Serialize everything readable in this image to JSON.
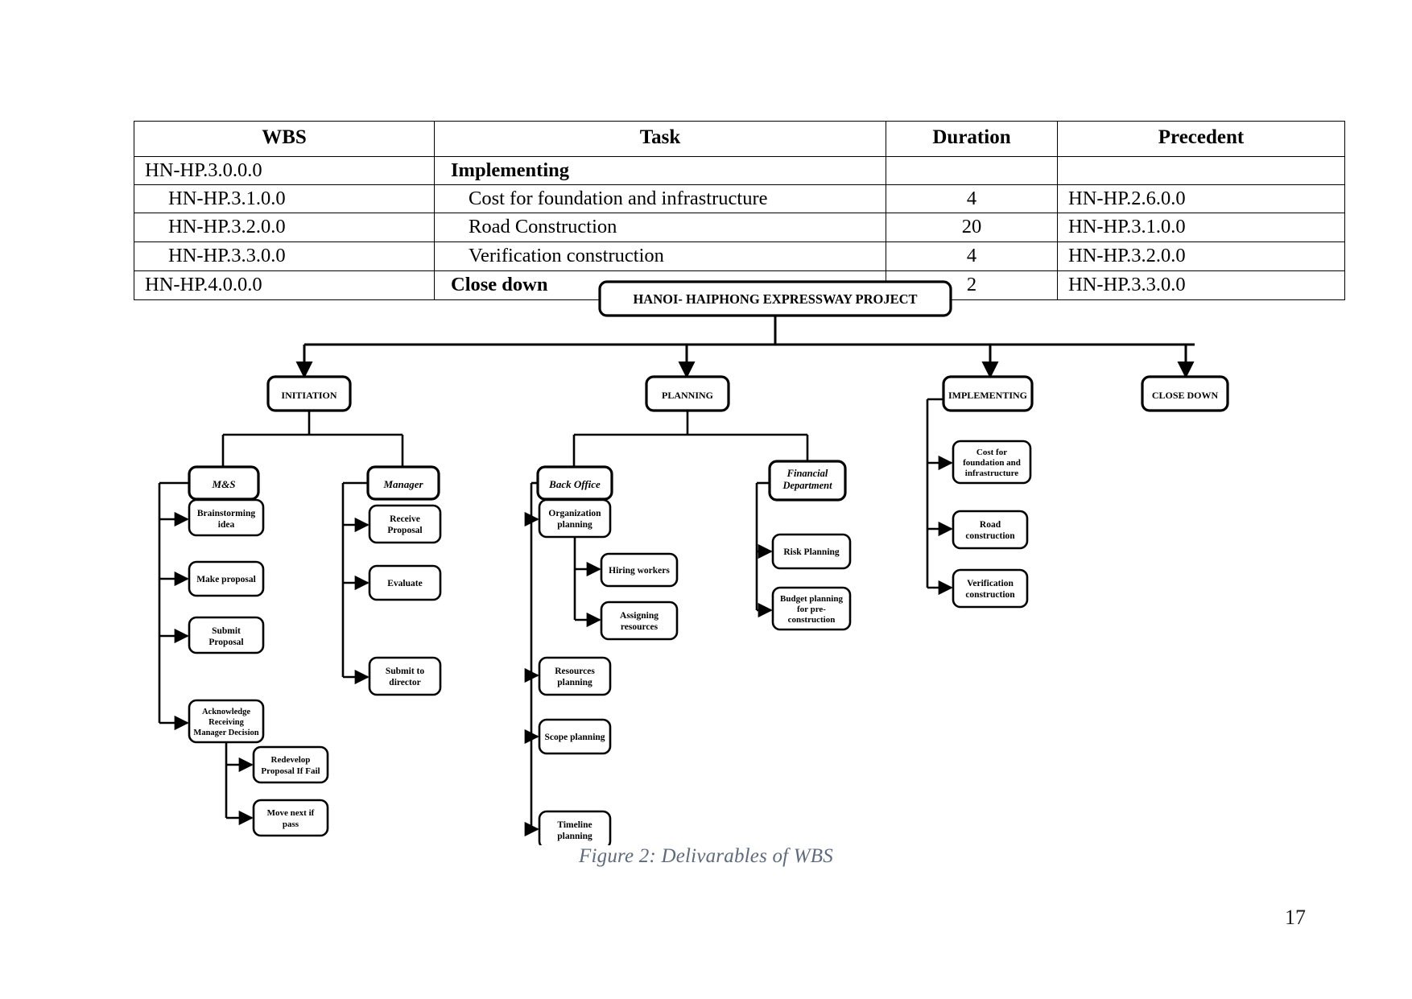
{
  "table": {
    "headers": [
      "WBS",
      "Task",
      "Duration",
      "Precedent"
    ],
    "rows": [
      {
        "wbs": "HN-HP.3.0.0.0",
        "task": "Implementing",
        "duration": "",
        "precedent": "",
        "wbs_indent": false,
        "task_bold": true,
        "task_indent": false
      },
      {
        "wbs": "HN-HP.3.1.0.0",
        "task": "Cost for foundation and infrastructure",
        "duration": "4",
        "precedent": "HN-HP.2.6.0.0",
        "wbs_indent": true,
        "task_bold": false,
        "task_indent": true
      },
      {
        "wbs": "HN-HP.3.2.0.0",
        "task": "Road Construction",
        "duration": "20",
        "precedent": "HN-HP.3.1.0.0",
        "wbs_indent": true,
        "task_bold": false,
        "task_indent": true
      },
      {
        "wbs": "HN-HP.3.3.0.0",
        "task": "Verification construction",
        "duration": "4",
        "precedent": "HN-HP.3.2.0.0",
        "wbs_indent": true,
        "task_bold": false,
        "task_indent": true
      },
      {
        "wbs": "HN-HP.4.0.0.0",
        "task": "Close down",
        "duration": "2",
        "precedent": "HN-HP.3.3.0.0",
        "wbs_indent": false,
        "task_bold": true,
        "task_indent": false
      }
    ]
  },
  "diagram": {
    "root": "HANOI- HAIPHONG EXPRESSWAY PROJECT",
    "phases": [
      "INITIATION",
      "PLANNING",
      "IMPLEMENTING",
      "CLOSE DOWN"
    ],
    "initiation": {
      "ms": "M&S",
      "ms_children": [
        "Brainstorming idea",
        "Make proposal",
        "Submit Proposal",
        "Acknowledge Receiving Manager Decision"
      ],
      "ack_children": [
        "Redevelop Proposal If Fail",
        "Move next if pass"
      ],
      "manager": "Manager",
      "manager_children": [
        "Receive Proposal",
        "Evaluate",
        "Submit to director"
      ]
    },
    "planning": {
      "back_office": "Back Office",
      "back_office_children": [
        "Organization planning",
        "Resources planning",
        "Scope planning",
        "Timeline planning"
      ],
      "organization_children": [
        "Hiring workers",
        "Assigning resources"
      ],
      "financial": "Financial Department",
      "financial_children": [
        "Risk Planning",
        "Budget planning for pre-construction"
      ]
    },
    "implementing_children": [
      "Cost for foundation and infrastructure",
      "Road construction",
      "Verification construction"
    ]
  },
  "caption": "Figure 2: Delivarables of WBS",
  "page_number": "17",
  "colors": {
    "caption": "#5e6a7d",
    "line": "#000000",
    "box_fill": "#ffffff"
  }
}
